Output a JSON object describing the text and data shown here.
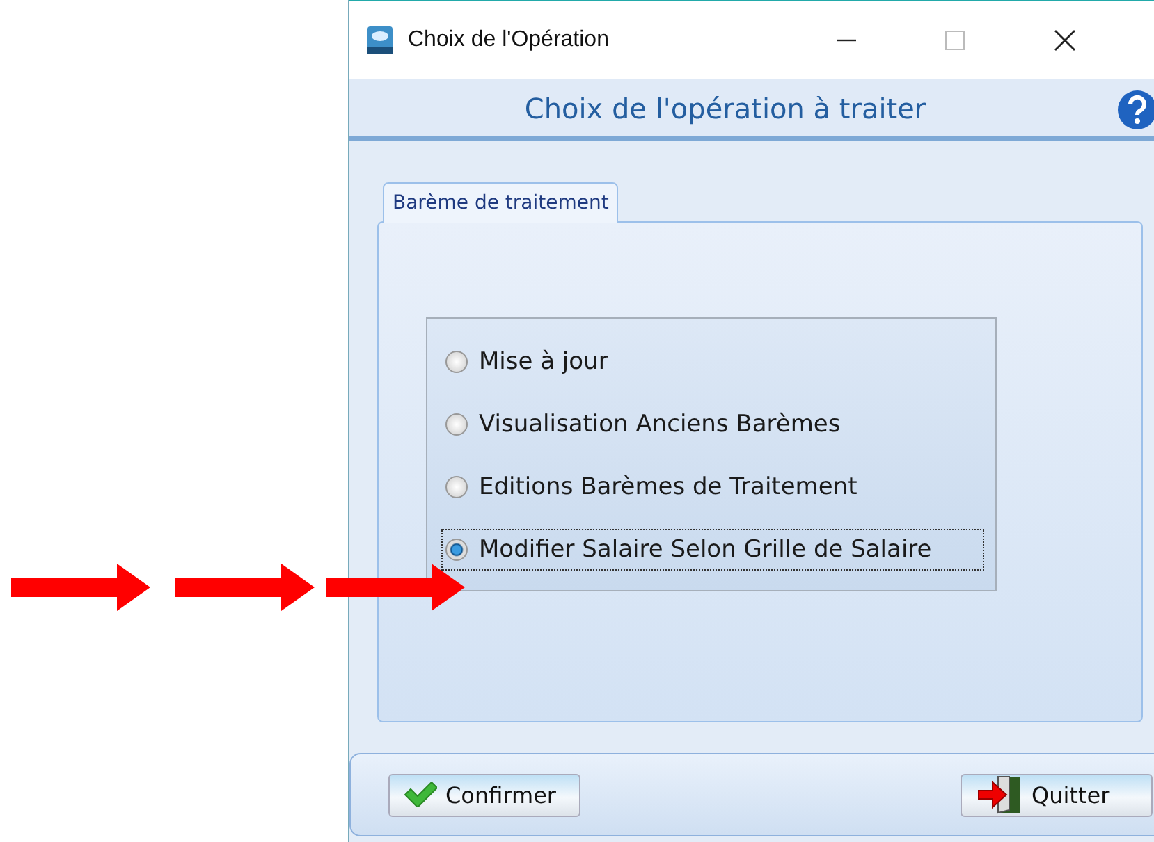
{
  "window": {
    "title": "Choix de l'Opération"
  },
  "header": {
    "title": "Choix de l'opération à traiter"
  },
  "tabs": [
    {
      "label": "Barème de traitement",
      "selected": true
    }
  ],
  "options": [
    {
      "label": "Mise à jour",
      "selected": false
    },
    {
      "label": "Visualisation Anciens Barèmes",
      "selected": false
    },
    {
      "label": "Editions Barèmes de Traitement",
      "selected": false
    },
    {
      "label": "Modifier Salaire Selon Grille de Salaire",
      "selected": true
    }
  ],
  "buttons": [
    {
      "kind": "confirm",
      "label": "Confirmer"
    },
    {
      "kind": "quit",
      "label": "Quitter"
    }
  ],
  "annotations": [
    {
      "kind": "arrow"
    },
    {
      "kind": "arrow"
    },
    {
      "kind": "arrow"
    }
  ]
}
